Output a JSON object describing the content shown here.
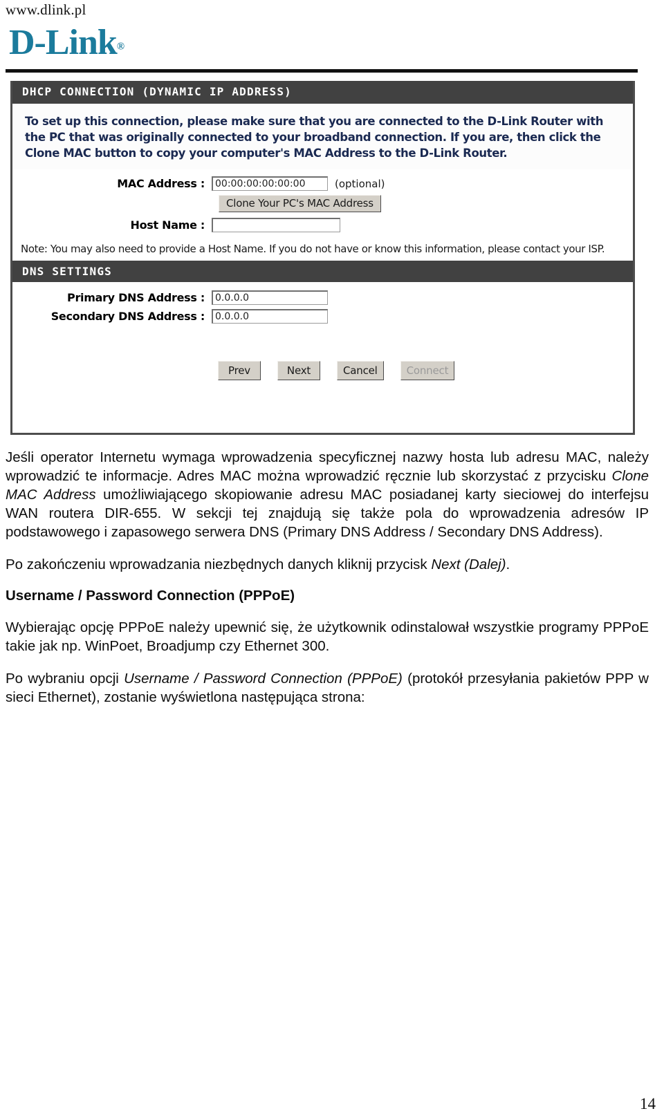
{
  "header": {
    "site_url": "www.dlink.pl",
    "brand_name": "D-Link",
    "brand_registered_mark": "®",
    "brand_color": "#1b7b9c"
  },
  "router_panel": {
    "dhcp_section": {
      "title": "DHCP CONNECTION (DYNAMIC IP ADDRESS)",
      "title_bar_color": "#414141",
      "intro_text": "To set up this connection, please make sure that you are connected to the D-Link Router with the PC that was originally connected to your broadband connection. If you are, then click the Clone MAC button to copy your computer's MAC Address to the D-Link Router.",
      "intro_text_color": "#1b2a52",
      "mac_address": {
        "label": "MAC Address :",
        "value": "00:00:00:00:00:00",
        "placeholder": "",
        "suffix": "(optional)"
      },
      "clone_button_label": "Clone Your PC's MAC Address",
      "host_name": {
        "label": "Host Name :",
        "value": "",
        "placeholder": ""
      },
      "note": "Note: You may also need to provide a Host Name. If you do not have or know this information, please contact your ISP."
    },
    "dns_section": {
      "title": "DNS SETTINGS",
      "primary_dns": {
        "label": "Primary DNS Address :",
        "value": "0.0.0.0",
        "placeholder": ""
      },
      "secondary_dns": {
        "label": "Secondary DNS Address :",
        "value": "0.0.0.0",
        "placeholder": ""
      }
    },
    "buttons": [
      {
        "label": "Prev",
        "disabled": false
      },
      {
        "label": "Next",
        "disabled": false
      },
      {
        "label": "Cancel",
        "disabled": false
      },
      {
        "label": "Connect",
        "disabled": true
      }
    ]
  },
  "prose": {
    "paragraph_1_part_1": "Jeśli operator Internetu wymaga wprowadzenia specyficznej nazwy hosta lub adresu MAC, należy wprowadzić te informacje. Adres MAC można wprowadzić ręcznie lub skorzystać z przycisku ",
    "paragraph_1_italic_1": "Clone MAC Address",
    "paragraph_1_part_2": " umożliwiającego skopiowanie adresu MAC posiadanej karty sieciowej do interfejsu WAN routera DIR-655. W sekcji tej znajdują się także pola do wprowadzenia adresów IP podstawowego i zapasowego serwera DNS (Primary DNS Address / Secondary DNS Address).",
    "paragraph_2_part_1": "Po zakończeniu wprowadzania niezbędnych danych kliknij przycisk ",
    "paragraph_2_italic_1": "Next (Dalej)",
    "paragraph_2_part_2": ".",
    "heading_1": "Username / Password Connection (PPPoE)",
    "paragraph_3": "Wybierając opcję PPPoE należy upewnić się, że użytkownik odinstalował wszystkie programy PPPoE takie jak np. WinPoet, Broadjump czy Ethernet 300.",
    "paragraph_4_part_1": "Po wybraniu opcji ",
    "paragraph_4_italic_1": "Username / Password Connection (PPPoE)",
    "paragraph_4_part_2": " (protokół przesyłania pakietów PPP w sieci Ethernet), zostanie wyświetlona następująca strona:"
  },
  "footer": {
    "page_number": "14"
  }
}
